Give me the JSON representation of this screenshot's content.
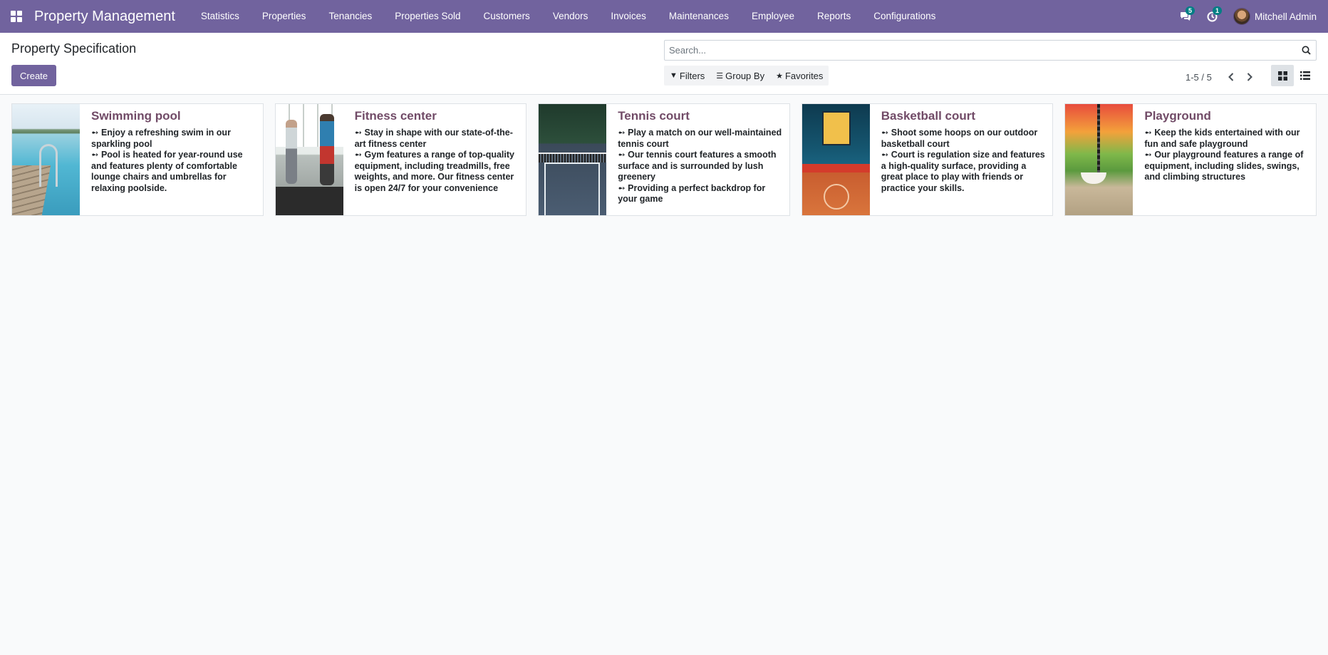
{
  "navbar": {
    "app_name": "Property Management",
    "menu": [
      "Statistics",
      "Properties",
      "Tenancies",
      "Properties Sold",
      "Customers",
      "Vendors",
      "Invoices",
      "Maintenances",
      "Employee",
      "Reports",
      "Configurations"
    ],
    "messages_count": "5",
    "activities_count": "1",
    "user_name": "Mitchell Admin",
    "color": "#71639e"
  },
  "control_panel": {
    "title": "Property Specification",
    "create_label": "Create",
    "search_placeholder": "Search...",
    "filters_label": "Filters",
    "group_by_label": "Group By",
    "favorites_label": "Favorites",
    "pager_value": "1-5 / 5",
    "active_view": "kanban"
  },
  "cards": [
    {
      "title": "Swimming pool",
      "image": "swimming-pool",
      "lines": [
        "➻ Enjoy a refreshing swim in our sparkling pool",
        "➻ Pool is heated for year-round use and features plenty of comfortable lounge chairs and umbrellas for relaxing poolside."
      ]
    },
    {
      "title": "Fitness center",
      "image": "fitness-center",
      "lines": [
        "➻ Stay in shape with our state-of-the-art fitness center",
        "➻ Gym features a range of top-quality equipment, including treadmills, free weights, and more. Our fitness center is open 24/7 for your convenience"
      ]
    },
    {
      "title": "Tennis court",
      "image": "tennis-court",
      "lines": [
        "➻ Play a match on our well-maintained tennis court",
        "➻ Our tennis court features a smooth surface and is surrounded by lush greenery",
        "➻ Providing a perfect backdrop for your game"
      ]
    },
    {
      "title": "Basketball court",
      "image": "basketball-court",
      "lines": [
        "➻ Shoot some hoops on our outdoor basketball court",
        "➻ Court is regulation size and features a high-quality surface, providing a great place to play with friends or practice your skills."
      ]
    },
    {
      "title": "Playground",
      "image": "playground",
      "lines": [
        "➻ Keep the kids entertained with our fun and safe playground",
        "➻ Our playground features a range of equipment, including slides, swings, and climbing structures"
      ]
    }
  ],
  "colors": {
    "primary": "#71639e",
    "card_title": "#714b67",
    "badge": "#017e84",
    "background": "#f9fafb"
  }
}
